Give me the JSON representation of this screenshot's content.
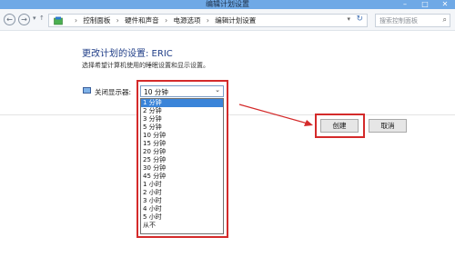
{
  "window": {
    "title": "编辑计划设置"
  },
  "nav": {
    "back": "←",
    "forward": "→",
    "up": "↑",
    "breadcrumbs": [
      "控制面板",
      "硬件和声音",
      "电源选项",
      "编辑计划设置"
    ],
    "search_placeholder": "搜索控制面板"
  },
  "page": {
    "heading": "更改计划的设置: ERIC",
    "subtext": "选择希望计算机使用的睡眠设置和显示设置。",
    "display_label": "关闭显示器:"
  },
  "dropdown": {
    "selected": "10 分钟",
    "highlighted_index": 0,
    "options": [
      "1 分钟",
      "2 分钟",
      "3 分钟",
      "5 分钟",
      "10 分钟",
      "15 分钟",
      "20 分钟",
      "25 分钟",
      "30 分钟",
      "45 分钟",
      "1 小时",
      "2 小时",
      "3 小时",
      "4 小时",
      "5 小时",
      "从不"
    ]
  },
  "buttons": {
    "create": "创建",
    "cancel": "取消"
  },
  "colors": {
    "annotation": "#d42a2a",
    "highlight": "#3a84d9",
    "heading": "#1f3d87"
  }
}
